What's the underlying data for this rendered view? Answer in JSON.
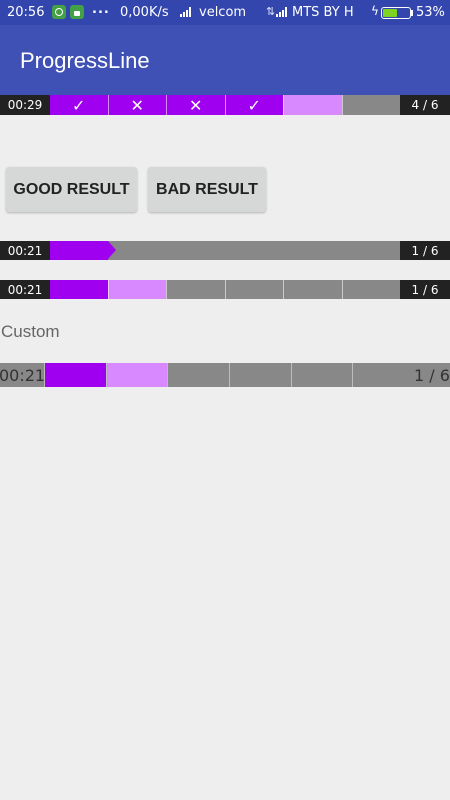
{
  "status_bar": {
    "time": "20:56",
    "dots": "...",
    "speed": "0,00K/s",
    "carrier1": "velcom",
    "data_indicator": "⇅",
    "carrier2": "MTS BY H",
    "charging": "ϟ",
    "battery_pct": "53%",
    "battery_level": 0.53
  },
  "app_bar": {
    "title": "ProgressLine"
  },
  "colors": {
    "done": "#a000f0",
    "current": "#d889ff",
    "pending": "#888888",
    "label_bg": "#222222"
  },
  "line1": {
    "time": "00:29",
    "count": "4 / 6",
    "segments": [
      {
        "state": "done",
        "mark": "✓"
      },
      {
        "state": "done",
        "mark": "✕"
      },
      {
        "state": "done",
        "mark": "✕"
      },
      {
        "state": "done",
        "mark": "✓"
      },
      {
        "state": "current",
        "mark": ""
      },
      {
        "state": "pending",
        "mark": ""
      }
    ]
  },
  "buttons": {
    "good": "GOOD RESULT",
    "bad": "BAD RESULT"
  },
  "line2": {
    "time": "00:21",
    "count": "1 / 6",
    "progress": 0.167
  },
  "line3": {
    "time": "00:21",
    "count": "1 / 6",
    "segments": [
      {
        "state": "done"
      },
      {
        "state": "current"
      },
      {
        "state": "pending"
      },
      {
        "state": "pending"
      },
      {
        "state": "pending"
      },
      {
        "state": "pending"
      }
    ]
  },
  "custom_label": "Custom",
  "line4": {
    "time": "00:21",
    "count": "1 / 6",
    "segments": [
      {
        "state": "done"
      },
      {
        "state": "current"
      },
      {
        "state": "pending"
      },
      {
        "state": "pending"
      },
      {
        "state": "pending"
      },
      {
        "state": "pending"
      }
    ]
  }
}
